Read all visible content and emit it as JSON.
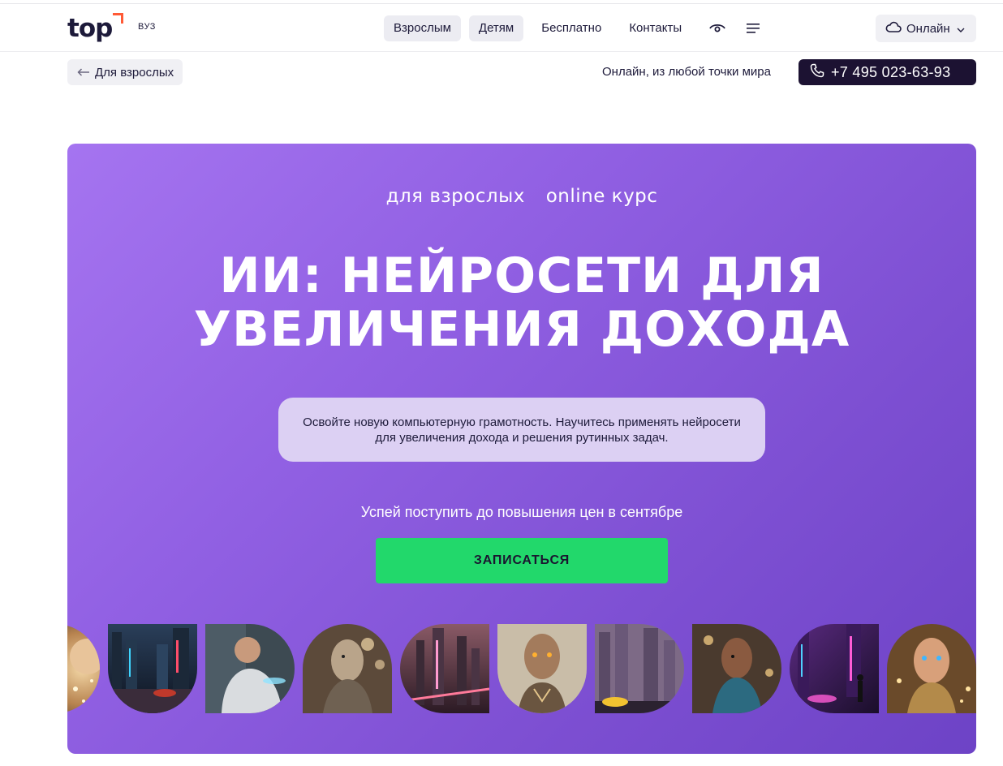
{
  "header": {
    "logo_text": "top",
    "logo_sub": "ВУЗ",
    "nav": [
      {
        "label": "Взрослым",
        "highlighted": true
      },
      {
        "label": "Детям",
        "highlighted": true
      },
      {
        "label": "Бесплатно",
        "highlighted": false
      },
      {
        "label": "Контакты",
        "highlighted": false
      }
    ],
    "icons": [
      "eye-icon",
      "menu-icon"
    ],
    "format_select": {
      "label": "Онлайн",
      "icon": "cloud-icon"
    }
  },
  "subbar": {
    "back_label": "Для взрослых",
    "online_note": "Онлайн, из любой точки мира",
    "phone": "+7 495 023-63-93"
  },
  "hero": {
    "tags": [
      "для взрослых",
      "online курс"
    ],
    "title_line1": "ИИ: НЕЙРОСЕТИ ДЛЯ",
    "title_line2": "УВЕЛИЧЕНИЯ ДОХОДА",
    "description": "Освойте новую компьютерную грамотность. Научитесь применять нейросети для увеличения дохода и решения рутинных задач.",
    "deadline": "Успей поступить до повышения цен в сентябре",
    "cta": "ЗАПИСАТЬСЯ"
  },
  "colors": {
    "accent_green": "#22d86b",
    "hero_purple": "#8a5adf",
    "dark": "#1c1232",
    "logo_orange": "#ff5a36"
  }
}
